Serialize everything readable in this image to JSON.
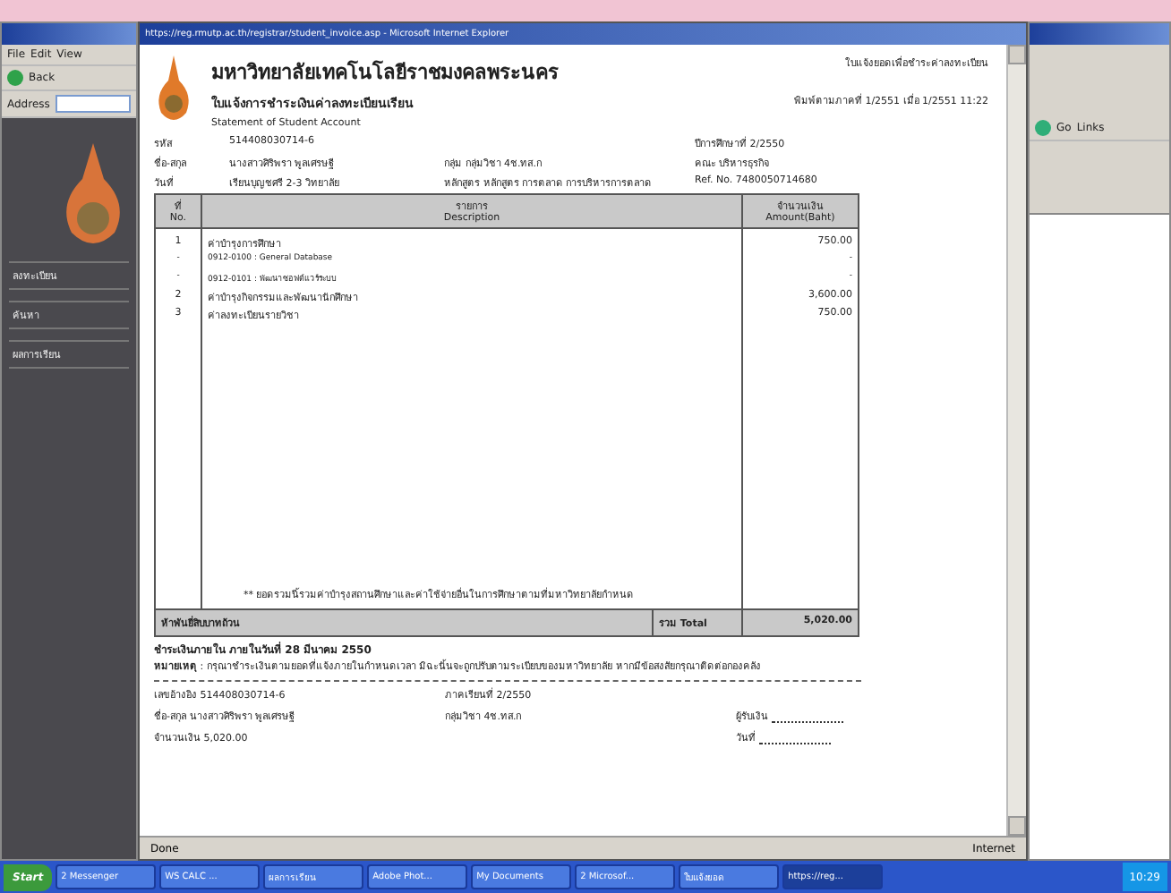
{
  "left_window": {
    "menu": [
      "File",
      "Edit",
      "View"
    ],
    "back_label": "Back",
    "address_label": "Address",
    "nav_items": [
      "ลงทะเบียน",
      "ค้นหา",
      "ผลการเรียน"
    ]
  },
  "browser": {
    "title": "https://reg.rmutp.ac.th/registrar/student_invoice.asp - Microsoft Internet Explorer",
    "document": {
      "university": "มหาวิทยาลัยเทคโนโลยีราชมงคลพระนคร",
      "subtitle": "ใบแจ้งการชำระเงินค่าลงทะเบียนเรียน",
      "subtitle_en": "Statement of Student Account",
      "office": "ใบแจ้งยอดเพื่อชำระค่าลงทะเบียน",
      "print_date": "พิมพ์ตามภาคที่ 1/2551 เมื่อ 1/2551 11:22",
      "info": [
        {
          "label": "รหัส",
          "value": "514408030714-6",
          "label3": "ปีการศึกษาที่ 2/2550"
        },
        {
          "label": "ชื่อ-สกุล",
          "value": "นางสาวศิริพรา พูลเศรษฐี",
          "label2": "กลุ่ม",
          "value2": "กลุ่มวิชา 4ช.ทส.ก",
          "label3": "คณะ บริหารธุรกิจ"
        },
        {
          "label": "วันที่",
          "value": "เรียนบุญชศรี 2-3 วิทยาลัย",
          "label2": "หลักสูตร",
          "value2": "หลักสูตร การตลาด การบริหารการตลาด",
          "label3": "Ref. No. 7480050714680"
        }
      ],
      "table": {
        "columns": [
          [
            "ที่",
            "No."
          ],
          [
            "รายการ",
            "Description"
          ],
          [
            "จำนวนเงิน",
            "Amount(Baht)"
          ]
        ],
        "rows": [
          {
            "no": "1",
            "desc": "ค่าบำรุงการศึกษา",
            "amount": "750.00",
            "sub": false
          },
          {
            "no": "-",
            "desc": "0912-0100 : General Database",
            "amount": "-",
            "sub": true
          },
          {
            "no": "-",
            "desc": "0912-0101 : พัฒนาซอฟต์แวร์ระบบ",
            "amount": "-",
            "sub": true
          },
          {
            "no": "2",
            "desc": "ค่าบำรุงกิจกรรมและพัฒนานักศึกษา",
            "amount": "3,600.00",
            "sub": false
          },
          {
            "no": "3",
            "desc": "ค่าลงทะเบียนรายวิชา",
            "amount": "750.00",
            "sub": false
          }
        ],
        "note": "** ยอดรวมนี้รวมค่าบำรุงสถานศึกษาและค่าใช้จ่ายอื่นในการศึกษาตามที่มหาวิทยาลัยกำหนด",
        "total_caption": "ห้าพันยี่สิบบาทถ้วน",
        "total_label": "รวม Total",
        "total": "5,020.00"
      },
      "deadline": "ชำระเงินภายใน ภายในวันที่ 28 มีนาคม 2550",
      "remark": "**หมายเหตุ** : กรุณาชำระเงินตามยอดที่แจ้งภายในกำหนดเวลา มิฉะนั้นจะถูกปรับตามระเบียบของมหาวิทยาลัย หากมีข้อสงสัยกรุณาติดต่อกองคลัง",
      "slip": {
        "ref": "เลขอ้างอิง 514408030714-6",
        "year": "ภาคเรียนที่ 2/2550",
        "name_label": "ชื่อ-สกุล",
        "name": "นางสาวศิริพรา พูลเศรษฐี",
        "group": "กลุ่มวิชา 4ช.ทส.ก",
        "amount_label": "จำนวนเงิน",
        "amount": "5,020.00",
        "receiver": "ผู้รับเงิน",
        "date": "วันที่"
      }
    },
    "status": "Done",
    "zone": "Internet"
  },
  "right_window": {
    "go": "Go",
    "links": "Links"
  },
  "taskbar": {
    "start": "Start",
    "tasks": [
      {
        "label": "2 Messenger",
        "selected": false
      },
      {
        "label": "WS CALC ...",
        "selected": false
      },
      {
        "label": "ผลการเรียน",
        "selected": false
      },
      {
        "label": "Adobe Phot...",
        "selected": false
      },
      {
        "label": "My Documents",
        "selected": false
      },
      {
        "label": "2 Microsof...",
        "selected": false
      },
      {
        "label": "ใบแจ้งยอด",
        "selected": false
      },
      {
        "label": "https://reg...",
        "selected": true
      }
    ],
    "clock": "10:29"
  }
}
